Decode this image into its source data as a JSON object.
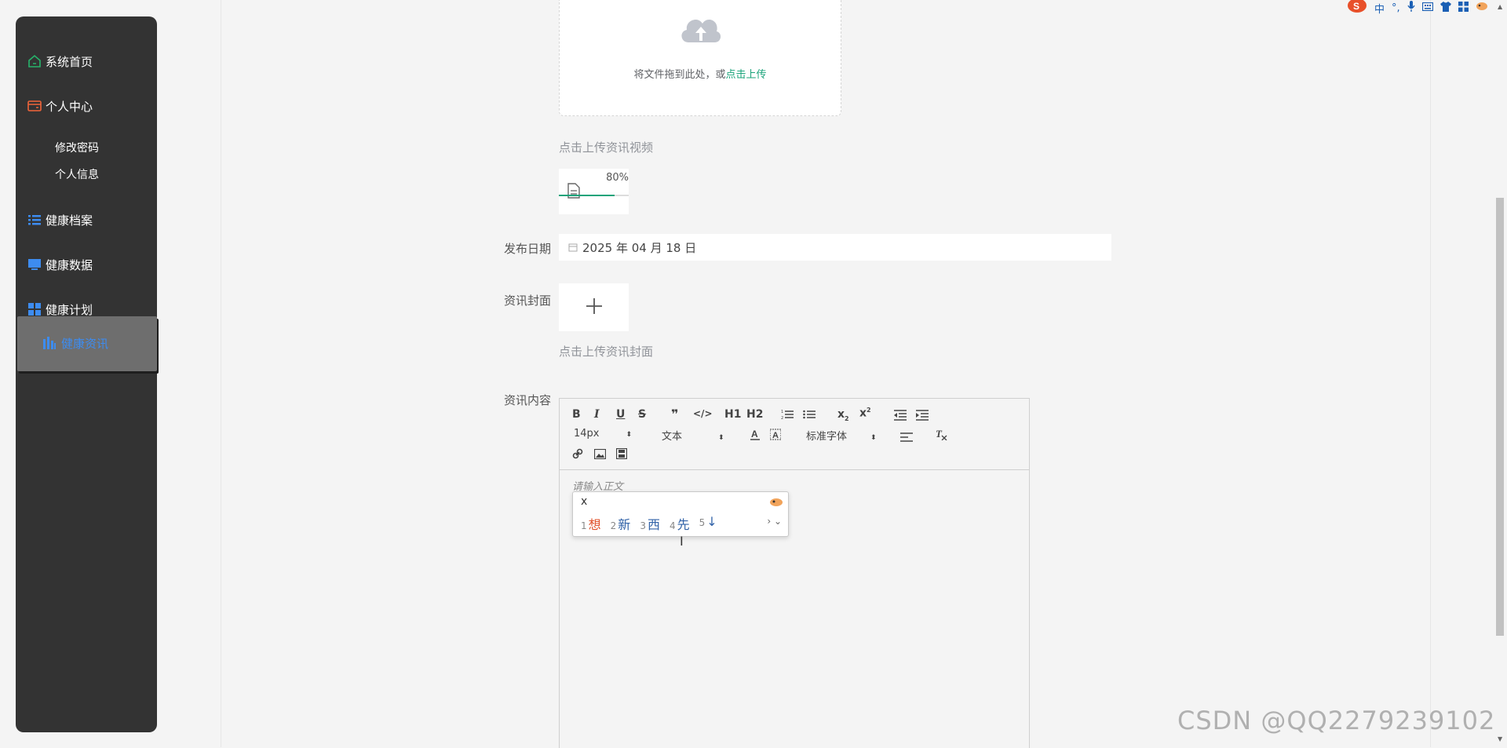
{
  "sidebar": {
    "items": [
      {
        "label": "系统首页",
        "icon": "home-icon",
        "color": "#27b36b"
      },
      {
        "label": "个人中心",
        "icon": "card-icon",
        "color": "#f1643a"
      },
      {
        "label": "健康档案",
        "icon": "list-icon",
        "color": "#3d8cf0"
      },
      {
        "label": "健康数据",
        "icon": "monitor-icon",
        "color": "#3d8cf0"
      },
      {
        "label": "健康计划",
        "icon": "grid-icon",
        "color": "#3d8cf0"
      },
      {
        "label": "健康资讯",
        "icon": "chart-icon",
        "color": "#3d8cf0"
      }
    ],
    "sub_items": [
      "修改密码",
      "个人信息"
    ],
    "active": "健康资讯"
  },
  "upload": {
    "text": "将文件拖到此处，或",
    "link": "点击上传"
  },
  "video": {
    "tip": "点击上传资讯视频",
    "progress_label": "80%",
    "progress": 0.8
  },
  "form": {
    "date_label": "发布日期",
    "date_value": "2025 年 04 月 18 日",
    "cover_label": "资讯封面",
    "cover_tip": "点击上传资讯封面",
    "content_label": "资讯内容"
  },
  "editor": {
    "font_size": "14px",
    "text_type": "文本",
    "font_family": "标准字体",
    "placeholder": "请输入正文",
    "toolbar": [
      "B",
      "I",
      "U",
      "S",
      "❞",
      "</>",
      "H1",
      "H2",
      "ol",
      "ul",
      "x2",
      "x²",
      "outdent",
      "indent"
    ]
  },
  "ime": {
    "input": "x",
    "candidates": [
      {
        "n": "1",
        "text": "想"
      },
      {
        "n": "2",
        "text": "新"
      },
      {
        "n": "3",
        "text": "西"
      },
      {
        "n": "4",
        "text": "先"
      },
      {
        "n": "5",
        "text": "↓"
      }
    ],
    "indicator": "中"
  },
  "watermark": "CSDN @QQ2279239102"
}
